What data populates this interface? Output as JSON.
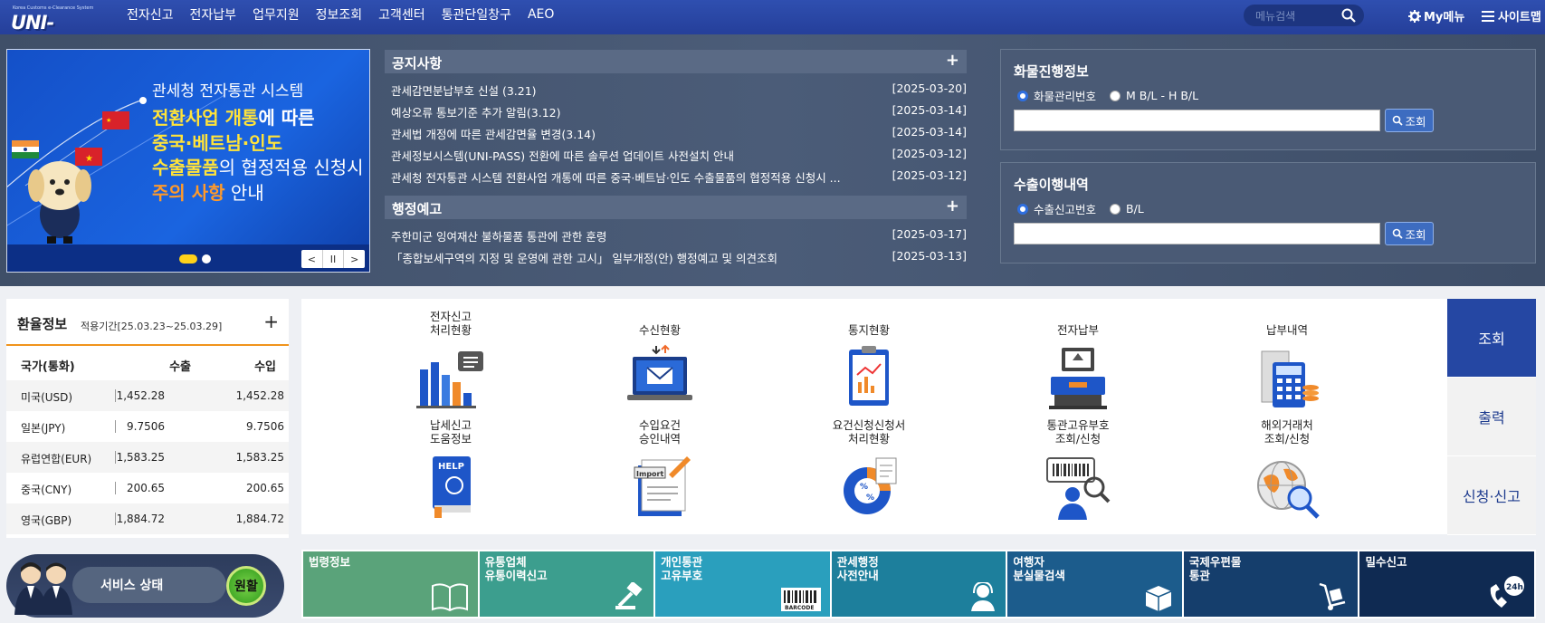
{
  "header": {
    "logo_small": "Korea Customs e-Clearance System",
    "logo_text": "UNI-PASS",
    "nav": [
      "전자신고",
      "전자납부",
      "업무지원",
      "정보조회",
      "고객센터",
      "통관단일창구",
      "AEO"
    ],
    "search_placeholder": "메뉴검색",
    "my_menu": "My메뉴",
    "sitemap": "사이트맵"
  },
  "banner": {
    "line1": "관세청 전자통관 시스템",
    "line2_a": "전환사업 개통",
    "line2_b": "에 따른",
    "line3_a": "중국·베트남·인도",
    "line4_a": "수출물품",
    "line4_b": "의 협정적용 신청시",
    "line5_a": "주의 사항",
    "line5_b": " 안내",
    "controls": [
      "<",
      "II",
      ">"
    ]
  },
  "notice": {
    "title": "공지사항",
    "more": "+",
    "items": [
      {
        "title": "관세감면분납부호 신설 (3.21)",
        "date": "[2025-03-20]"
      },
      {
        "title": "예상오류 통보기준 추가 알림(3.12)",
        "date": "[2025-03-14]"
      },
      {
        "title": "관세법 개정에 따른 관세감면율 변경(3.14)",
        "date": "[2025-03-14]"
      },
      {
        "title": "관세정보시스템(UNI-PASS) 전환에 따른 솔루션 업데이트 사전설치 안내",
        "date": "[2025-03-12]"
      },
      {
        "title": "관세청 전자통관 시스템 전환사업 개통에 따른 중국·베트남·인도 수출물품의 협정적용 신청시 ...",
        "date": "[2025-03-12]"
      }
    ]
  },
  "admin": {
    "title": "행정예고",
    "more": "+",
    "items": [
      {
        "title": "주한미군 잉여재산 불하물품 통관에 관한 훈령",
        "date": "[2025-03-17]"
      },
      {
        "title": "「종합보세구역의 지정 및 운영에 관한 고시」 일부개정(안) 행정예고 및 의견조회",
        "date": "[2025-03-13]"
      }
    ]
  },
  "cargo": {
    "title": "화물진행정보",
    "opt1": "화물관리번호",
    "opt2": "M B/L - H B/L",
    "btn": "조회"
  },
  "export": {
    "title": "수출이행내역",
    "opt1": "수출신고번호",
    "opt2": "B/L",
    "btn": "조회"
  },
  "rates": {
    "title": "환율정보",
    "period": "적용기간[25.03.23~25.03.29]",
    "more": "+",
    "head": [
      "국가(통화)",
      "수출",
      "수입"
    ],
    "rows": [
      [
        "미국(USD)",
        "1,452.28",
        "1,452.28"
      ],
      [
        "일본(JPY)",
        "9.7506",
        "9.7506"
      ],
      [
        "유럽연합(EUR)",
        "1,583.25",
        "1,583.25"
      ],
      [
        "중국(CNY)",
        "200.65",
        "200.65"
      ],
      [
        "영국(GBP)",
        "1,884.72",
        "1,884.72"
      ]
    ]
  },
  "service": {
    "label": "서비스 상태",
    "status": "원활"
  },
  "tiles": [
    {
      "l1": "전자신고",
      "l2": "처리현황",
      "icon": "bar-chart-icon"
    },
    {
      "l1": "",
      "l2": "수신현황",
      "icon": "laptop-mail-icon"
    },
    {
      "l1": "",
      "l2": "통지현황",
      "icon": "clipboard-icon"
    },
    {
      "l1": "",
      "l2": "전자납부",
      "icon": "payment-terminal-icon"
    },
    {
      "l1": "",
      "l2": "납부내역",
      "icon": "calculator-icon"
    },
    {
      "l1": "납세신고",
      "l2": "도움정보",
      "icon": "help-book-icon"
    },
    {
      "l1": "수입요건",
      "l2": "승인내역",
      "icon": "import-doc-icon"
    },
    {
      "l1": "요건신청신청서",
      "l2": "처리현황",
      "icon": "percent-chart-icon"
    },
    {
      "l1": "통관고유부호",
      "l2": "조회/신청",
      "icon": "barcode-person-icon"
    },
    {
      "l1": "해외거래처",
      "l2": "조회/신청",
      "icon": "globe-search-icon"
    }
  ],
  "side_tabs": [
    "조회",
    "출력",
    "신청·신고"
  ],
  "quick": [
    {
      "l1": "법령정보",
      "l2": "",
      "color": "#5aa37a",
      "icon": "book-icon"
    },
    {
      "l1": "유통업체",
      "l2": "유통이력신고",
      "color": "#3c9e8e",
      "icon": "hammer-icon"
    },
    {
      "l1": "개인통관",
      "l2": "고유부호",
      "color": "#2a9fbd",
      "icon": "barcode-icon"
    },
    {
      "l1": "관세행정",
      "l2": "사전안내",
      "color": "#1d7f9c",
      "icon": "headset-icon"
    },
    {
      "l1": "여행자",
      "l2": "분실물검색",
      "color": "#1c5c8c",
      "icon": "box-icon"
    },
    {
      "l1": "국제우편물",
      "l2": "통관",
      "color": "#153e6c",
      "icon": "trolley-icon"
    },
    {
      "l1": "밀수신고",
      "l2": "",
      "color": "#0f2a52",
      "icon": "phone-24h-icon",
      "badge": "24h"
    }
  ]
}
